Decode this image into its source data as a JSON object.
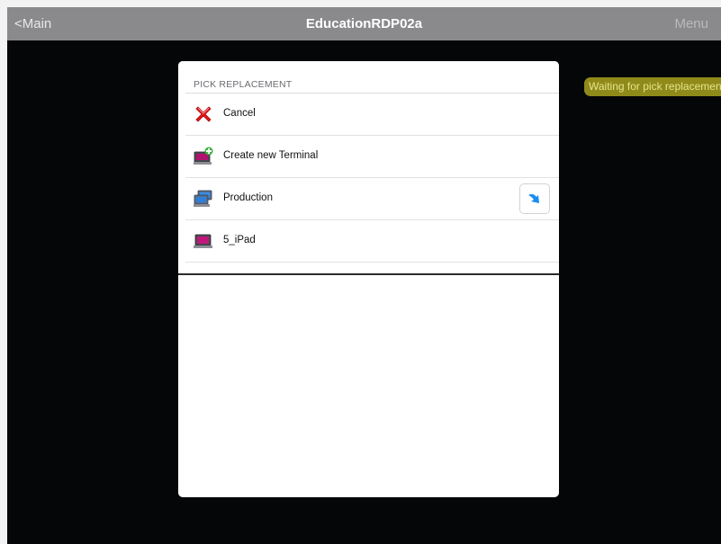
{
  "navbar": {
    "back_label": "<Main",
    "title": "EducationRDP02a",
    "menu_label": "Menu"
  },
  "status": {
    "text": "Waiting for pick replacement"
  },
  "picker": {
    "section_title": "PICK REPLACEMENT",
    "items": [
      {
        "label": "Cancel",
        "icon": "cancel-x-icon"
      },
      {
        "label": "Create new Terminal",
        "icon": "new-terminal-icon"
      },
      {
        "label": "Production",
        "icon": "terminal-group-icon"
      },
      {
        "label": "5_iPad",
        "icon": "terminal-icon"
      }
    ]
  },
  "colors": {
    "navbar_bg": "#8a8a8c",
    "screen_bg": "#050608",
    "status_bg": "#8f8a1a",
    "accent_blue": "#1a8cf0"
  }
}
